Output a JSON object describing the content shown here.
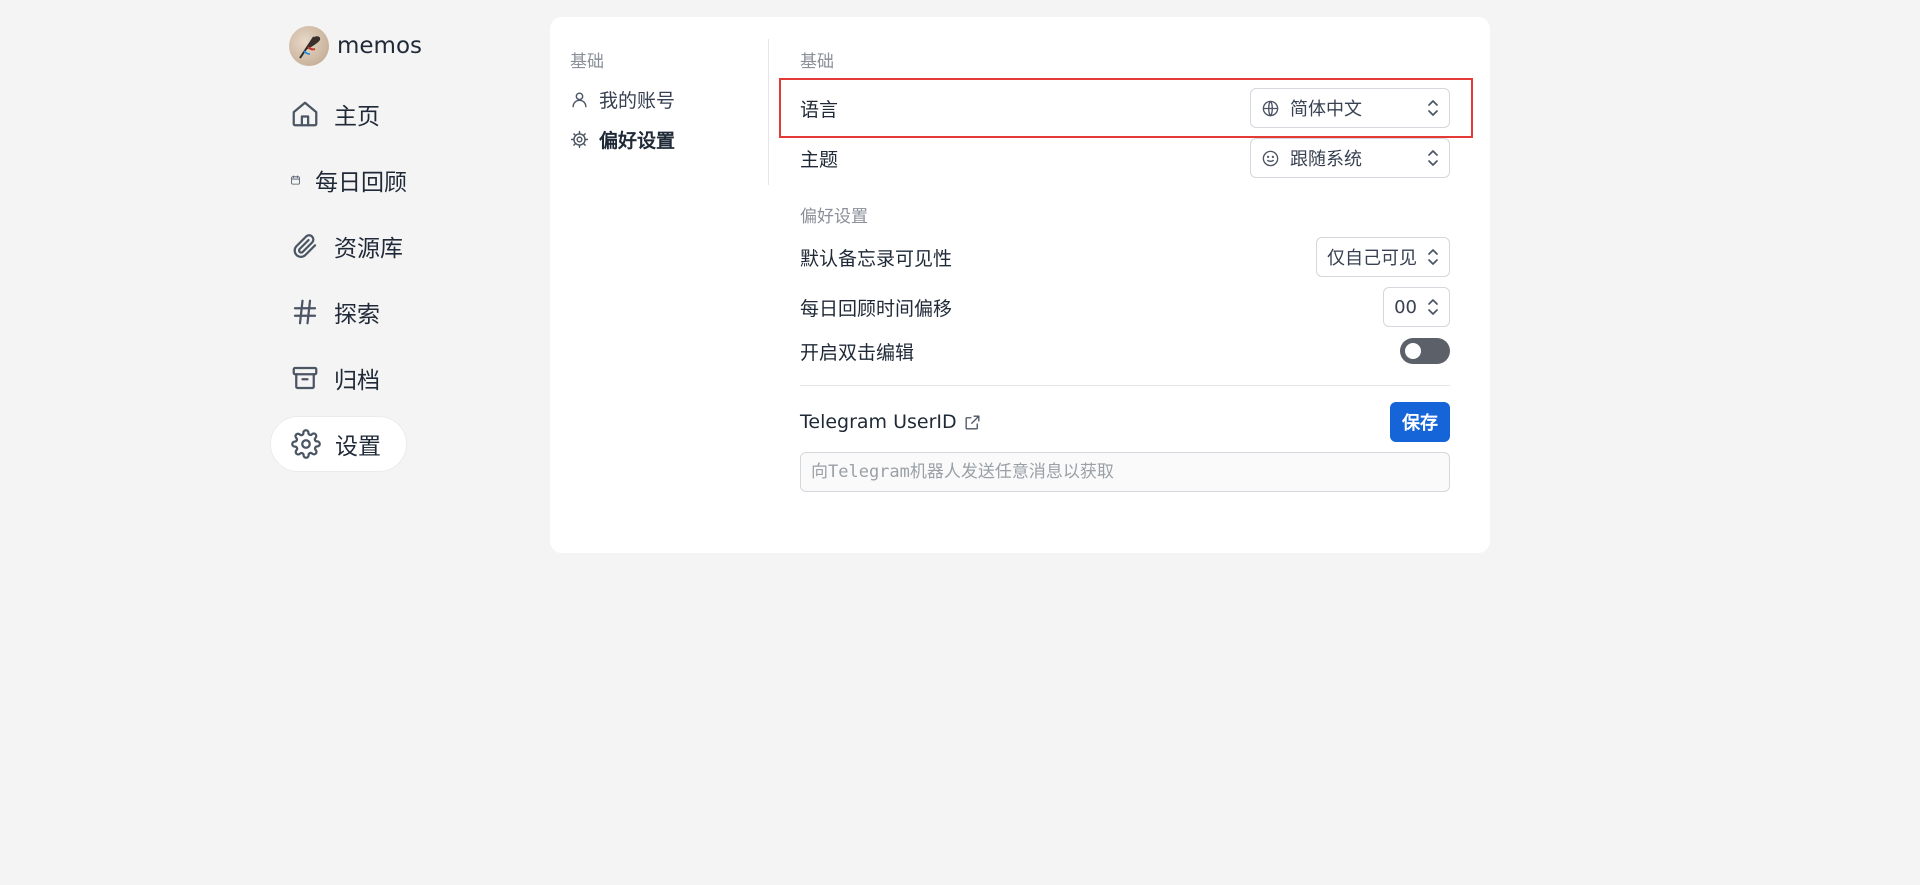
{
  "brand": {
    "name": "memos"
  },
  "nav": {
    "items": [
      {
        "label": "主页",
        "icon": "home-icon"
      },
      {
        "label": "每日回顾",
        "icon": "calendar-icon"
      },
      {
        "label": "资源库",
        "icon": "paperclip-icon"
      },
      {
        "label": "探索",
        "icon": "hash-icon"
      },
      {
        "label": "归档",
        "icon": "archive-icon"
      },
      {
        "label": "设置",
        "icon": "gear-icon",
        "active": true
      }
    ]
  },
  "settings": {
    "subnav": {
      "group_title": "基础",
      "items": [
        {
          "label": "我的账号",
          "icon": "user-icon"
        },
        {
          "label": "偏好设置",
          "icon": "gear-icon",
          "active": true
        }
      ]
    },
    "basic": {
      "title": "基础",
      "language": {
        "label": "语言",
        "value": "简体中文",
        "icon": "globe-icon"
      },
      "theme": {
        "label": "主题",
        "value": "跟随系统",
        "icon": "smile-icon"
      }
    },
    "preferences": {
      "title": "偏好设置",
      "visibility": {
        "label": "默认备忘录可见性",
        "value": "仅自己可见"
      },
      "review_offset": {
        "label": "每日回顾时间偏移",
        "value": "00"
      },
      "double_click": {
        "label": "开启双击编辑",
        "enabled": false
      }
    },
    "telegram": {
      "label": "Telegram UserID",
      "save_label": "保存",
      "placeholder": "向Telegram机器人发送任意消息以获取",
      "value": ""
    }
  },
  "colors": {
    "page_bg": "#f4f4f4",
    "primary": "#1565d8",
    "highlight": "#e53935",
    "toggle_off": "#5b6069"
  }
}
